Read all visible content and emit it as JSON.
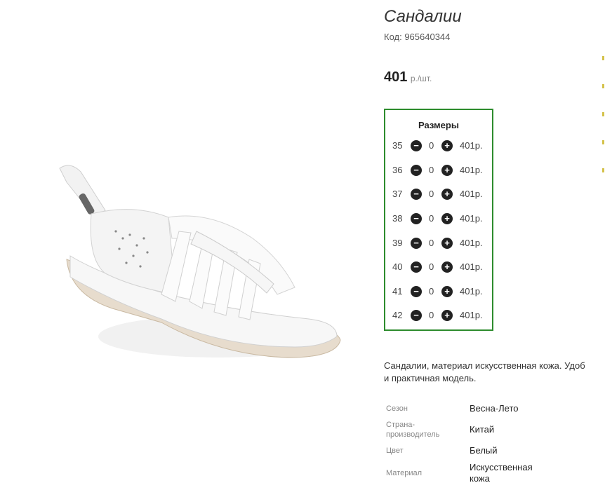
{
  "product": {
    "title": "Сандалии",
    "sku": "Код: 965640344",
    "price": "401",
    "price_unit": "р./шт."
  },
  "sizes": {
    "title": "Размеры",
    "rows": [
      {
        "size": "35",
        "qty": "0",
        "price": "401р."
      },
      {
        "size": "36",
        "qty": "0",
        "price": "401р."
      },
      {
        "size": "37",
        "qty": "0",
        "price": "401р."
      },
      {
        "size": "38",
        "qty": "0",
        "price": "401р."
      },
      {
        "size": "39",
        "qty": "0",
        "price": "401р."
      },
      {
        "size": "40",
        "qty": "0",
        "price": "401р."
      },
      {
        "size": "41",
        "qty": "0",
        "price": "401р."
      },
      {
        "size": "42",
        "qty": "0",
        "price": "401р."
      }
    ],
    "minus_icon": "minus-circle-icon",
    "plus_icon": "plus-circle-icon"
  },
  "description": {
    "line1": "Сандалии, материал искусственная кожа. Удоб",
    "line2": "и практичная модель."
  },
  "specs": [
    {
      "label": "Сезон",
      "value": "Весна-Лето"
    },
    {
      "label_line1": "Страна-",
      "label_line2": "производитель",
      "value": "Китай"
    },
    {
      "label": "Цвет",
      "value": "Белый"
    },
    {
      "label": "Материал",
      "value_line1": "Искусственная",
      "value_line2": "кожа"
    }
  ],
  "colors": {
    "accent_border": "#2d8c2d",
    "button_bg": "#222222"
  }
}
